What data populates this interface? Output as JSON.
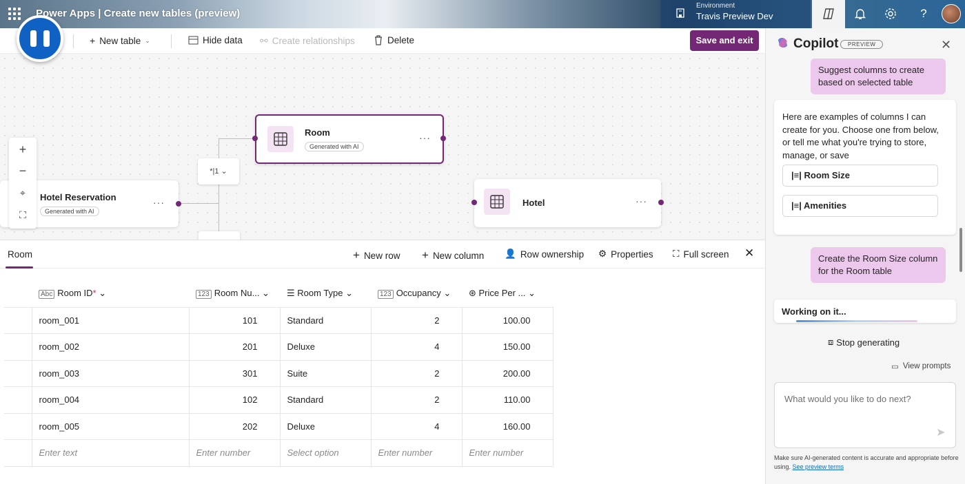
{
  "header": {
    "app_title": "Power Apps  |  Create new tables (preview)",
    "env_label": "Environment",
    "env_name": "Travis Preview Dev"
  },
  "cmdbar": {
    "new_table": "New table",
    "hide_data": "Hide data",
    "create_relationships": "Create relationships",
    "delete": "Delete",
    "save_exit": "Save and exit"
  },
  "canvas": {
    "nodes": [
      {
        "name": "Room",
        "badge": "Generated with AI"
      },
      {
        "name": "Hotel Reservation",
        "badge": "Generated with AI"
      },
      {
        "name": "Hotel",
        "badge": ""
      }
    ],
    "relationship_symbol": "*|1"
  },
  "grid": {
    "tab": "Room",
    "toolbar": {
      "new_row": "New row",
      "new_column": "New column",
      "row_ownership": "Row ownership",
      "properties": "Properties",
      "full_screen": "Full screen"
    },
    "columns": [
      "Room ID",
      "Room Nu...",
      "Room Type",
      "Occupancy",
      "Price Per ..."
    ],
    "rows": [
      [
        "room_001",
        "101",
        "Standard",
        "2",
        "100.00"
      ],
      [
        "room_002",
        "201",
        "Deluxe",
        "4",
        "150.00"
      ],
      [
        "room_003",
        "301",
        "Suite",
        "2",
        "200.00"
      ],
      [
        "room_004",
        "102",
        "Standard",
        "2",
        "110.00"
      ],
      [
        "room_005",
        "202",
        "Deluxe",
        "4",
        "160.00"
      ]
    ],
    "placeholders": [
      "Enter text",
      "Enter number",
      "Select option",
      "Enter number",
      "Enter number"
    ]
  },
  "copilot": {
    "title": "Copilot",
    "preview_badge": "PREVIEW",
    "user_msg_1": "Suggest columns to create based on selected table",
    "bot_msg_1": "Here are examples of columns I can create for you. Choose one from below, or tell me what you're trying to store, manage, or save",
    "suggestions": [
      "Room Size",
      "Amenities"
    ],
    "user_msg_2": "Create the Room Size column for the Room table",
    "working": "Working on it...",
    "stop_generating": "Stop generating",
    "view_prompts": "View prompts",
    "input_placeholder": "What would you like to do next?",
    "disclaimer": "Make sure AI-generated content is accurate and appropriate before using.",
    "disclaimer_link": "See preview terms"
  },
  "colors": {
    "accent": "#742774",
    "accent_light": "#ecc9ec",
    "link": "#0f6cbd"
  }
}
